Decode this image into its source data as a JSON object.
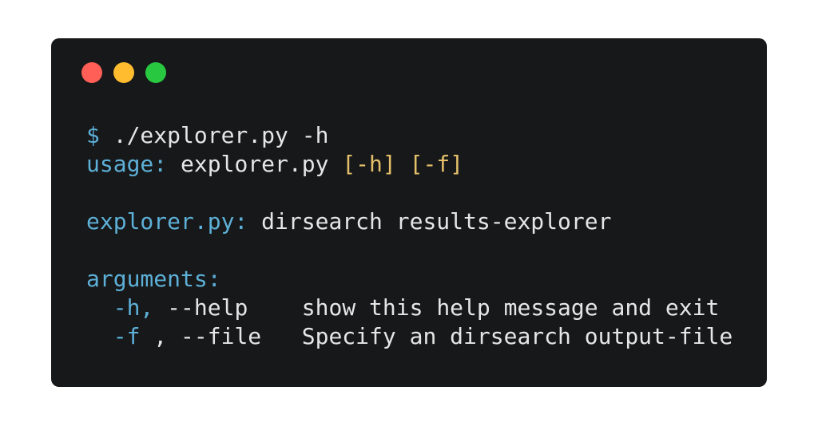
{
  "window": {
    "buttons": {
      "close_color": "#ff5f57",
      "minimize_color": "#febc2e",
      "zoom_color": "#28c840"
    }
  },
  "terminal": {
    "prompt": "$",
    "command": "./explorer.py -h",
    "usage_label": "usage:",
    "usage_program": "explorer.py",
    "usage_opt_h": "[-h]",
    "usage_opt_f": "[-f]",
    "desc_program": "explorer.py:",
    "desc_text": "dirsearch results-explorer",
    "arguments_heading": "arguments:",
    "arg1_short": "-h,",
    "arg1_long": "--help",
    "arg1_help": "show this help message and exit",
    "arg2_short": "-f",
    "arg2_long": ", --file",
    "arg2_help": "Specify an dirsearch output-file"
  }
}
